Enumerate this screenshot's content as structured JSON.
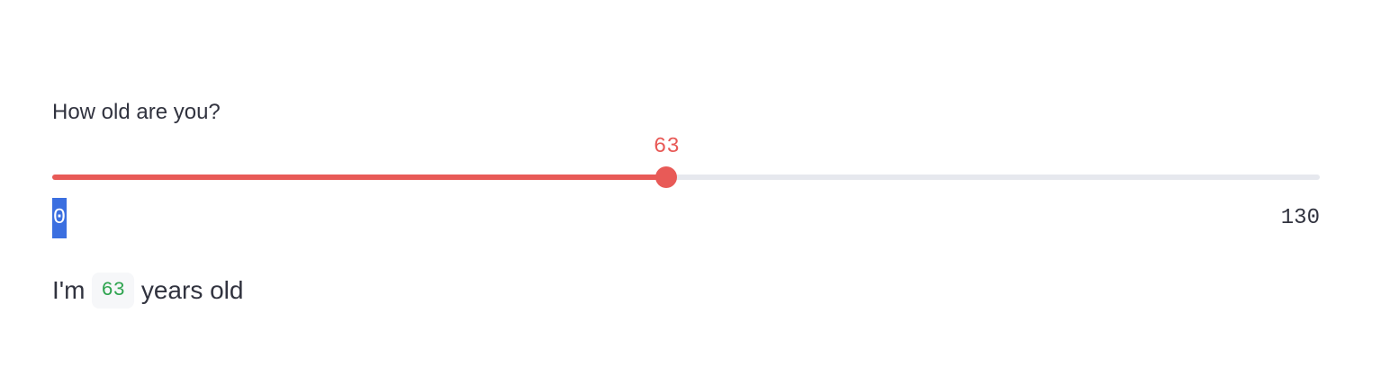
{
  "slider": {
    "label": "How old are you?",
    "value": 63,
    "value_text": "63",
    "min": 0,
    "max": 130,
    "min_text": "0",
    "max_text": "130",
    "active_color": "#e85a57",
    "track_color": "#e6e8ee"
  },
  "result": {
    "prefix": "I'm",
    "value": "63",
    "suffix": "years old"
  }
}
